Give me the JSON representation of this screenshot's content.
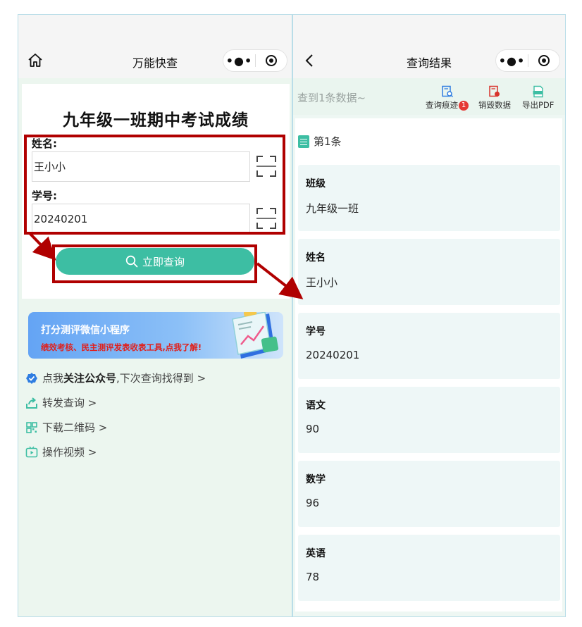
{
  "left": {
    "nav_title": "万能快查",
    "form_title": "九年级一班期中考试成绩",
    "fields": [
      {
        "label": "姓名:",
        "value": "王小小"
      },
      {
        "label": "学号:",
        "value": "20240201"
      }
    ],
    "query_button": "立即查询",
    "banner": {
      "title": "打分测评微信小程序",
      "subtitle": "绩效考核、民主测评发表收表工具,点我了解!"
    },
    "links": {
      "follow_prefix": "点我",
      "follow_bold": "关注公众号",
      "follow_suffix": ",下次查询找得到 >",
      "share": "转发查询 >",
      "qrcode": "下载二维码 >",
      "video": "操作视频 >"
    }
  },
  "right": {
    "nav_title": "查询结果",
    "summary": "查到1条数据~",
    "tools": {
      "trace": "查询痕迹",
      "trace_badge": "1",
      "destroy": "销毁数据",
      "export": "导出PDF"
    },
    "record_title": "第1条",
    "fields": [
      {
        "label": "班级",
        "value": "九年级一班"
      },
      {
        "label": "姓名",
        "value": "王小小"
      },
      {
        "label": "学号",
        "value": "20240201"
      },
      {
        "label": "语文",
        "value": "90"
      },
      {
        "label": "数学",
        "value": "96"
      },
      {
        "label": "英语",
        "value": "78"
      }
    ]
  },
  "capsule": {
    "more": "•●•"
  },
  "colors": {
    "accent": "#3dbea3",
    "annotation": "#b00000",
    "badge": "#e53935",
    "banner_sub": "#e0201c"
  }
}
